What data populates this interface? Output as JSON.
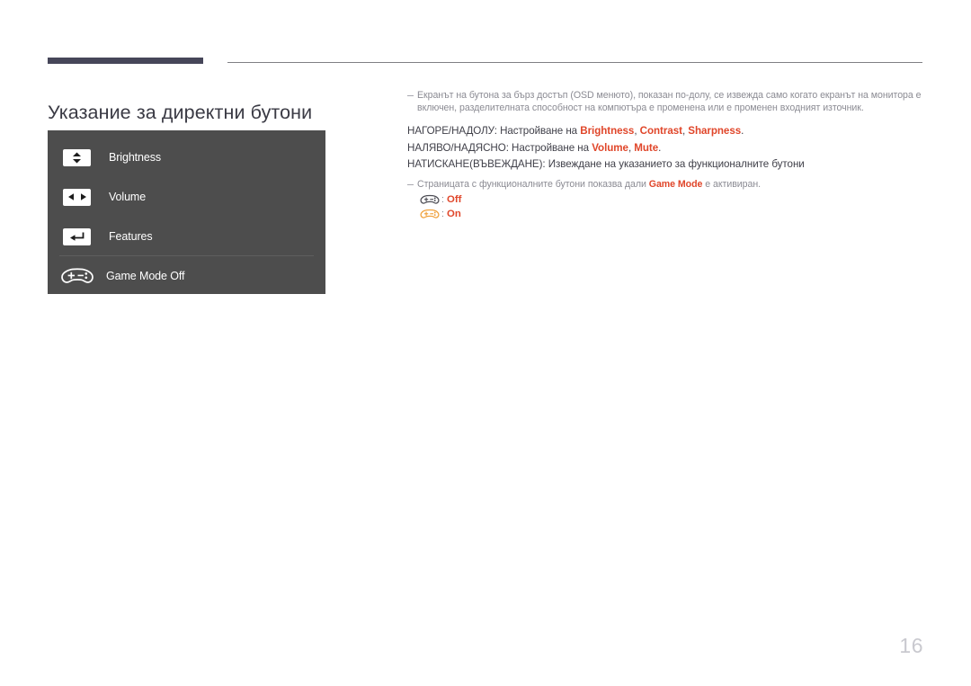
{
  "page": {
    "title": "Указание за директни бутони",
    "number": "16",
    "accent_color": "#e0462a",
    "rule_color": "#464659",
    "panel_bg": "#4d4d4d",
    "body_text_color": "#8b8b93",
    "gamepad_off_color": "#4d4d55",
    "gamepad_on_color": "#f0a13c"
  },
  "osd_panel": {
    "rows": [
      {
        "icon": "up-down-arrows-icon",
        "label": "Brightness"
      },
      {
        "icon": "left-right-arrows-icon",
        "label": "Volume"
      },
      {
        "icon": "enter-return-arrow-icon",
        "label": "Features"
      },
      {
        "icon": "gamepad-icon",
        "label": "Game Mode Off"
      }
    ]
  },
  "notes": {
    "intro": "Екранът на бутона за бърз достъп (OSD менюто), показан по-долу, се извежда само когато екранът на монитора е включен, разделителната способност на компютъра е променена или е променен входният източник.",
    "game_mode_note_prefix": "Страницата с функционалните бутони показва дали ",
    "game_mode_note_bold": "Game Mode",
    "game_mode_note_suffix": " е активиран."
  },
  "instructions": [
    {
      "prefix": "НАГОРЕ/НАДОЛУ: Настройване на ",
      "items": [
        "Brightness",
        "Contrast",
        "Sharpness"
      ],
      "suffix": "."
    },
    {
      "prefix": "НАЛЯВО/НАДЯСНО: Настройване на ",
      "items": [
        "Volume",
        "Mute"
      ],
      "suffix": "."
    },
    {
      "prefix": "НАТИСКАНЕ(ВЪВЕЖДАНЕ): Извеждане на указанието за функционалните бутони",
      "items": [],
      "suffix": ""
    }
  ],
  "game_mode_states": [
    {
      "icon": "gamepad-off-icon",
      "separator": ":",
      "state": "Off"
    },
    {
      "icon": "gamepad-on-icon",
      "separator": ":",
      "state": "On"
    }
  ]
}
